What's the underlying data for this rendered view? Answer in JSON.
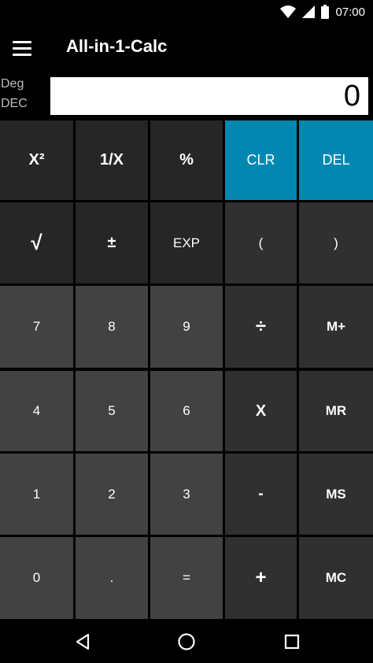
{
  "status_bar": {
    "time": "07:00"
  },
  "app_bar": {
    "title": "All-in-1-Calc",
    "menu_icon": "hamburger-menu-icon"
  },
  "mode": {
    "angle": "Deg",
    "base": "DEC"
  },
  "display": {
    "value": "0"
  },
  "colors": {
    "accent": "#0288b0",
    "function_key": "#262626",
    "number_key": "#424242",
    "operator_key": "#303030"
  },
  "keys": {
    "x_squared": "X²",
    "reciprocal": "1/X",
    "percent": "%",
    "clear": "CLR",
    "delete": "DEL",
    "sqrt": "√",
    "plus_minus": "±",
    "exp": "EXP",
    "open_paren": "(",
    "close_paren": ")",
    "seven": "7",
    "eight": "8",
    "nine": "9",
    "divide": "÷",
    "memory_plus": "M+",
    "four": "4",
    "five": "5",
    "six": "6",
    "multiply": "X",
    "memory_recall": "MR",
    "one": "1",
    "two": "2",
    "three": "3",
    "minus": "-",
    "memory_store": "MS",
    "zero": "0",
    "decimal": ".",
    "equals": "=",
    "plus": "+",
    "memory_clear": "MC"
  },
  "nav_bar": {
    "back_icon": "back-triangle-icon",
    "home_icon": "home-circle-icon",
    "recents_icon": "recents-square-icon"
  }
}
